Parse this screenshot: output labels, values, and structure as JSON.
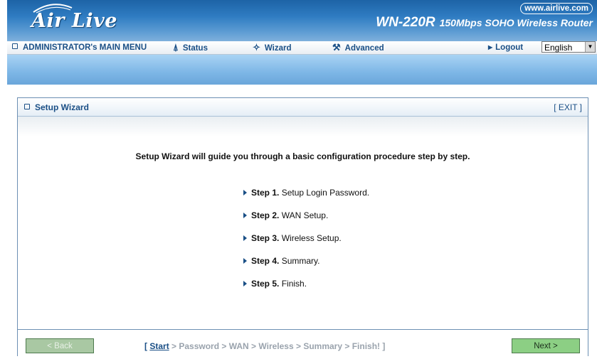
{
  "header": {
    "logo_text": "Air Live",
    "website": "www.airlive.com",
    "model": "WN-220R",
    "model_desc": "150Mbps SOHO Wireless Router"
  },
  "menu": {
    "main_menu": "ADMINISTRATOR's MAIN MENU",
    "status": "Status",
    "wizard": "Wizard",
    "advanced": "Advanced",
    "logout": "Logout",
    "language": "English"
  },
  "panel": {
    "title": "Setup Wizard",
    "exit": "[ EXIT ]",
    "intro": "Setup Wizard will guide you through a basic configuration procedure step by step.",
    "steps": [
      {
        "num": "Step 1.",
        "text": "Setup Login Password."
      },
      {
        "num": "Step 2.",
        "text": "WAN Setup."
      },
      {
        "num": "Step 3.",
        "text": "Wireless Setup."
      },
      {
        "num": "Step 4.",
        "text": "Summary."
      },
      {
        "num": "Step 5.",
        "text": "Finish."
      }
    ]
  },
  "footer": {
    "back_label": "< Back",
    "next_label": "Next >",
    "crumb_open": "[ ",
    "crumb_current": "Start",
    "crumb_rest": " > Password > WAN > Wireless > Summary > Finish! ]"
  },
  "colors": {
    "header_blue": "#2f7cc2",
    "link_blue": "#1a4f86",
    "next_green": "#8ccf84"
  }
}
